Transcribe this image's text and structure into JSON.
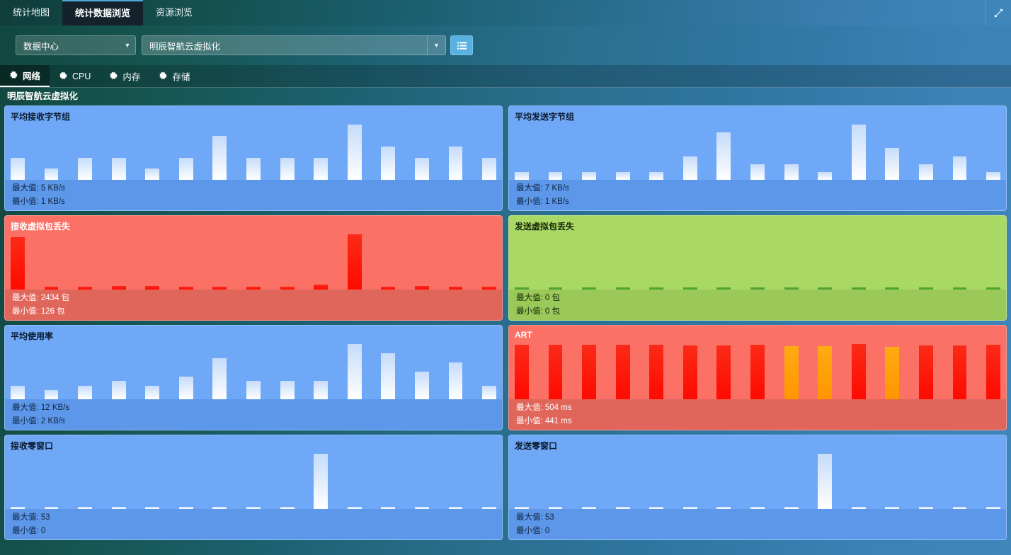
{
  "window": {
    "expand_icon": "expand-diagonal-icon"
  },
  "top_tabs": [
    {
      "label": "统计地图",
      "active": false
    },
    {
      "label": "统计数据浏览",
      "active": true
    },
    {
      "label": "资源浏览",
      "active": false
    }
  ],
  "selector": {
    "datacenter": {
      "value": "数据中心",
      "caret": "▼"
    },
    "object": {
      "value": "明辰智航云虚拟化",
      "caret": "▼"
    },
    "list_button_icon": "list-view-icon"
  },
  "metric_tabs": [
    {
      "label": "网络",
      "icon": "gear-icon",
      "active": true
    },
    {
      "label": "CPU",
      "icon": "gear-icon",
      "active": false
    },
    {
      "label": "内存",
      "icon": "gear-icon",
      "active": false
    },
    {
      "label": "存储",
      "icon": "gear-icon",
      "active": false
    }
  ],
  "group_title": "明辰智航云虚拟化",
  "labels": {
    "max": "最大值",
    "min": "最小值"
  },
  "chart_data": [
    {
      "id": "avg-recv-bytes",
      "type": "bar",
      "title": "平均接收字节组",
      "theme": "blue",
      "unit": "KB/s",
      "max_label": "最大值: 5 KB/s",
      "min_label": "最小值: 1 KB/s",
      "max": 5,
      "min": 1,
      "ylim": [
        0,
        5
      ],
      "values": [
        2,
        1,
        2,
        2,
        1,
        2,
        4,
        2,
        2,
        2,
        5,
        3,
        2,
        3,
        2
      ]
    },
    {
      "id": "avg-send-bytes",
      "type": "bar",
      "title": "平均发送字节组",
      "theme": "blue",
      "unit": "KB/s",
      "max_label": "最大值: 7 KB/s",
      "min_label": "最小值: 1 KB/s",
      "max": 7,
      "min": 1,
      "ylim": [
        0,
        7
      ],
      "values": [
        1,
        1,
        1,
        1,
        1,
        3,
        6,
        2,
        2,
        1,
        7,
        4,
        2,
        3,
        1
      ]
    },
    {
      "id": "recv-virtual-packet-loss",
      "type": "bar",
      "title": "接收虚拟包丢失",
      "theme": "red",
      "unit": "包",
      "max_label": "最大值: 2434 包",
      "min_label": "最小值: 126 包",
      "max": 2434,
      "min": 126,
      "ylim": [
        0,
        2434
      ],
      "values": [
        2320,
        140,
        140,
        150,
        150,
        140,
        140,
        140,
        140,
        210,
        2434,
        130,
        150,
        126,
        130
      ]
    },
    {
      "id": "send-virtual-packet-loss",
      "type": "bar",
      "title": "发送虚拟包丢失",
      "theme": "green",
      "unit": "包",
      "max_label": "最大值: 0 包",
      "min_label": "最小值: 0 包",
      "max": 0,
      "min": 0,
      "ylim": [
        0,
        1
      ],
      "values": [
        0,
        0,
        0,
        0,
        0,
        0,
        0,
        0,
        0,
        0,
        0,
        0,
        0,
        0,
        0
      ]
    },
    {
      "id": "avg-usage-rate",
      "type": "bar",
      "title": "平均使用率",
      "theme": "blue",
      "unit": "KB/s",
      "max_label": "最大值: 12 KB/s",
      "min_label": "最小值: 2 KB/s",
      "max": 12,
      "min": 2,
      "ylim": [
        0,
        12
      ],
      "values": [
        3,
        2,
        3,
        4,
        3,
        5,
        9,
        4,
        4,
        4,
        12,
        10,
        6,
        8,
        3
      ]
    },
    {
      "id": "art",
      "type": "bar",
      "title": "ART",
      "theme": "red",
      "unit": "ms",
      "max_label": "最大值: 504 ms",
      "min_label": "最小值: 441 ms",
      "max": 504,
      "min": 441,
      "ylim": [
        0,
        504
      ],
      "values": [
        498,
        500,
        498,
        497,
        498,
        489,
        490,
        495,
        486,
        484,
        504,
        477,
        490,
        491,
        498
      ],
      "warn_indices": [
        8,
        9,
        11
      ]
    },
    {
      "id": "recv-zero-window",
      "type": "bar",
      "title": "接收零窗口",
      "theme": "blue",
      "unit": "",
      "max_label": "最大值: 53",
      "min_label": "最小值: 0",
      "max": 53,
      "min": 0,
      "ylim": [
        0,
        53
      ],
      "values": [
        0,
        0,
        0,
        0,
        0,
        0,
        0,
        0,
        0,
        53,
        0,
        0,
        0,
        0,
        0
      ]
    },
    {
      "id": "send-zero-window",
      "type": "bar",
      "title": "发送零窗口",
      "theme": "blue",
      "unit": "",
      "max_label": "最大值: 53",
      "min_label": "最小值: 0",
      "max": 53,
      "min": 0,
      "ylim": [
        0,
        53
      ],
      "values": [
        0,
        0,
        0,
        0,
        0,
        0,
        0,
        0,
        0,
        53,
        0,
        0,
        0,
        0,
        0
      ]
    }
  ]
}
